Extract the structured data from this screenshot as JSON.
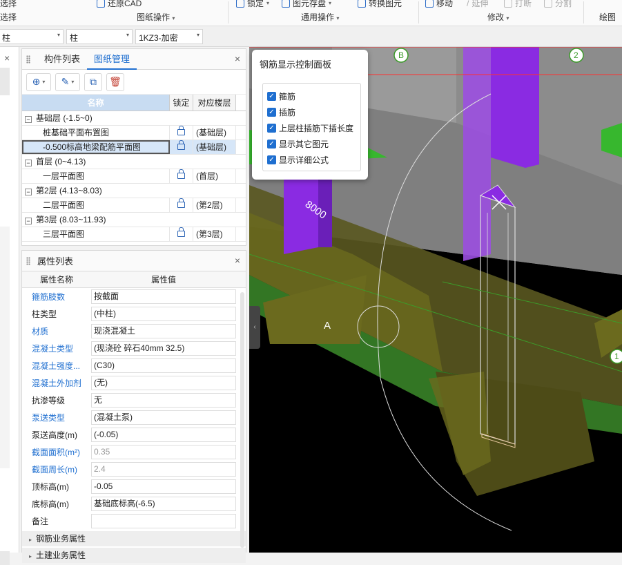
{
  "ribbon": {
    "top_items": [
      "选择",
      "还原CAD",
      "锁定",
      "图元存盘",
      "转换图元",
      "移动",
      "延伸",
      "打断",
      "分割"
    ],
    "groups": [
      "选择",
      "图纸操作",
      "通用操作",
      "修改",
      "绘图"
    ]
  },
  "filter_bar": {
    "floor_value": "柱",
    "type_value": "柱",
    "component_value": "1KZ3-加密"
  },
  "drawing_panel": {
    "tabs": [
      "构件列表",
      "图纸管理"
    ],
    "active_tab": "图纸管理",
    "columns": {
      "name": "名称",
      "lock": "锁定",
      "floor": "对应楼层"
    },
    "rows": [
      {
        "type": "group",
        "label": "基础层 (-1.5~0)",
        "expand": "−"
      },
      {
        "type": "item",
        "label": "桩基础平面布置图",
        "floor": "(基础层)"
      },
      {
        "type": "item",
        "label": "-0.500标高地梁配筋平面图",
        "floor": "(基础层)",
        "selected": true
      },
      {
        "type": "group",
        "label": "首层 (0~4.13)",
        "expand": "−"
      },
      {
        "type": "item",
        "label": "一层平面图",
        "floor": "(首层)"
      },
      {
        "type": "group",
        "label": "第2层 (4.13~8.03)",
        "expand": "−"
      },
      {
        "type": "item",
        "label": "二层平面图",
        "floor": "(第2层)"
      },
      {
        "type": "group",
        "label": "第3层 (8.03~11.93)",
        "expand": "−"
      },
      {
        "type": "item",
        "label": "三层平面图",
        "floor": "(第3层)"
      }
    ]
  },
  "property_panel": {
    "title": "属性列表",
    "columns": {
      "name": "属性名称",
      "value": "属性值"
    },
    "rows": [
      {
        "name": "箍筋肢数",
        "value": "按截面",
        "link": true
      },
      {
        "name": "柱类型",
        "value": "(中柱)"
      },
      {
        "name": "材质",
        "value": "现浇混凝土",
        "link": true
      },
      {
        "name": "混凝土类型",
        "value": "(现浇砼 碎石40mm 32.5)",
        "link": true
      },
      {
        "name": "混凝土强度...",
        "value": "(C30)",
        "link": true
      },
      {
        "name": "混凝土外加剂",
        "value": "(无)",
        "link": true
      },
      {
        "name": "抗渗等级",
        "value": "无"
      },
      {
        "name": "泵送类型",
        "value": "(混凝土泵)",
        "link": true
      },
      {
        "name": "泵送高度(m)",
        "value": "(-0.05)"
      },
      {
        "name": "截面面积(m²)",
        "value": "0.35",
        "link": true,
        "gray": true
      },
      {
        "name": "截面周长(m)",
        "value": "2.4",
        "link": true,
        "gray": true
      },
      {
        "name": "顶标高(m)",
        "value": "-0.05"
      },
      {
        "name": "底标高(m)",
        "value": "基础底标高(-6.5)"
      },
      {
        "name": "备注",
        "value": ""
      }
    ],
    "sections": [
      "钢筋业务属性",
      "土建业务属性"
    ]
  },
  "control_panel": {
    "title": "钢筋显示控制面板",
    "options": [
      {
        "label": "箍筋",
        "checked": true
      },
      {
        "label": "插筋",
        "checked": true
      },
      {
        "label": "上层柱插筋下插长度",
        "checked": true
      },
      {
        "label": "显示其它图元",
        "checked": true
      },
      {
        "label": "显示详细公式",
        "checked": true
      }
    ]
  },
  "viewport": {
    "axis_labels": [
      "B",
      "2",
      "A",
      "1"
    ],
    "dimension": "8000",
    "colors": {
      "purple": "#8a2be2",
      "olive": "#6b6a1e",
      "green": "#37b72e",
      "gray": "#8c8c8c"
    }
  }
}
